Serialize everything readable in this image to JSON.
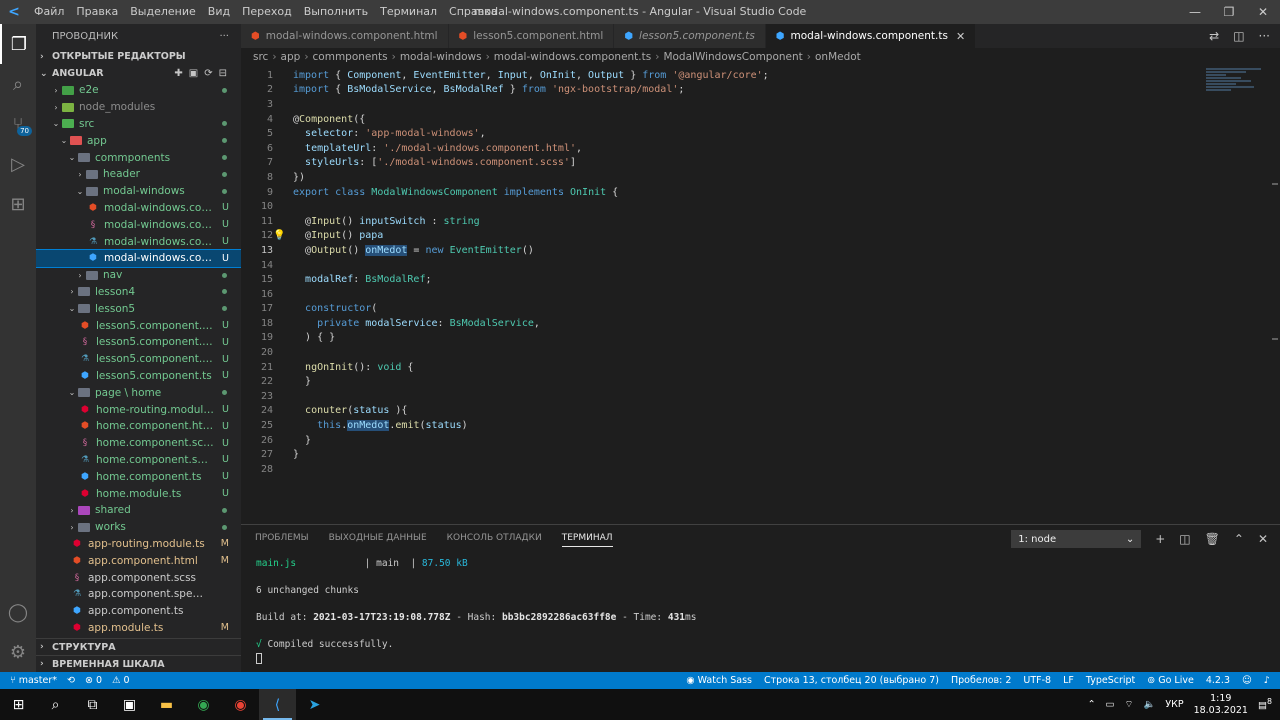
{
  "window": {
    "title": "modal-windows.component.ts - Angular - Visual Studio Code",
    "menu": [
      "Файл",
      "Правка",
      "Выделение",
      "Вид",
      "Переход",
      "Выполнить",
      "Терминал",
      "Справка"
    ]
  },
  "activity": {
    "scm_badge": "70"
  },
  "sidebar": {
    "title": "ПРОВОДНИК",
    "more": "···",
    "open_editors": "ОТКРЫТЫЕ РЕДАКТОРЫ",
    "project": "ANGULAR",
    "tree": [
      {
        "label": "e2e",
        "indent": 1,
        "kind": "folder",
        "fc": "e2e",
        "chev": "›",
        "status": "dot"
      },
      {
        "label": "node_modules",
        "indent": 1,
        "kind": "folder",
        "fc": "node",
        "chev": "›",
        "status": "",
        "ign": true
      },
      {
        "label": "src",
        "indent": 1,
        "kind": "folder",
        "fc": "src",
        "chev": "⌄",
        "status": "dot"
      },
      {
        "label": "app",
        "indent": 2,
        "kind": "folder",
        "fc": "app",
        "chev": "⌄",
        "status": "dot"
      },
      {
        "label": "commponents",
        "indent": 3,
        "kind": "folder",
        "fc": "",
        "chev": "⌄",
        "status": "dot"
      },
      {
        "label": "header",
        "indent": 4,
        "kind": "folder",
        "fc": "",
        "chev": "›",
        "status": "dot"
      },
      {
        "label": "modal-windows",
        "indent": 4,
        "kind": "folder",
        "fc": "",
        "chev": "⌄",
        "status": "dot"
      },
      {
        "label": "modal-windows.compo...",
        "indent": 5,
        "kind": "html",
        "status": "U"
      },
      {
        "label": "modal-windows.compo...",
        "indent": 5,
        "kind": "scss",
        "status": "U"
      },
      {
        "label": "modal-windows.compo...",
        "indent": 5,
        "kind": "spec",
        "status": "U"
      },
      {
        "label": "modal-windows.compo...",
        "indent": 5,
        "kind": "ts",
        "status": "U",
        "selected": true
      },
      {
        "label": "nav",
        "indent": 4,
        "kind": "folder",
        "fc": "",
        "chev": "›",
        "status": "dot"
      },
      {
        "label": "lesson4",
        "indent": 3,
        "kind": "folder",
        "fc": "",
        "chev": "›",
        "status": "dot"
      },
      {
        "label": "lesson5",
        "indent": 3,
        "kind": "folder",
        "fc": "",
        "chev": "⌄",
        "status": "dot"
      },
      {
        "label": "lesson5.component.html",
        "indent": 4,
        "kind": "html",
        "status": "U"
      },
      {
        "label": "lesson5.component.scss",
        "indent": 4,
        "kind": "scss",
        "status": "U"
      },
      {
        "label": "lesson5.component.spec.ts",
        "indent": 4,
        "kind": "spec",
        "status": "U"
      },
      {
        "label": "lesson5.component.ts",
        "indent": 4,
        "kind": "ts",
        "status": "U"
      },
      {
        "label": "page \\ home",
        "indent": 3,
        "kind": "folder",
        "fc": "",
        "chev": "⌄",
        "status": "dot"
      },
      {
        "label": "home-routing.module.ts",
        "indent": 4,
        "kind": "ng",
        "status": "U"
      },
      {
        "label": "home.component.html",
        "indent": 4,
        "kind": "html",
        "status": "U"
      },
      {
        "label": "home.component.scss",
        "indent": 4,
        "kind": "scss",
        "status": "U"
      },
      {
        "label": "home.component.spec.ts",
        "indent": 4,
        "kind": "spec",
        "status": "U"
      },
      {
        "label": "home.component.ts",
        "indent": 4,
        "kind": "ts",
        "status": "U"
      },
      {
        "label": "home.module.ts",
        "indent": 4,
        "kind": "ng",
        "status": "U"
      },
      {
        "label": "shared",
        "indent": 3,
        "kind": "folder",
        "fc": "shared",
        "chev": "›",
        "status": "dot"
      },
      {
        "label": "works",
        "indent": 3,
        "kind": "folder",
        "fc": "",
        "chev": "›",
        "status": "dot"
      },
      {
        "label": "app-routing.module.ts",
        "indent": 3,
        "kind": "ng",
        "status": "M"
      },
      {
        "label": "app.component.html",
        "indent": 3,
        "kind": "html",
        "status": "M"
      },
      {
        "label": "app.component.scss",
        "indent": 3,
        "kind": "scss",
        "status": ""
      },
      {
        "label": "app.component.spec.ts",
        "indent": 3,
        "kind": "spec",
        "status": ""
      },
      {
        "label": "app.component.ts",
        "indent": 3,
        "kind": "ts",
        "status": ""
      },
      {
        "label": "app.module.ts",
        "indent": 3,
        "kind": "ng",
        "status": "M"
      }
    ],
    "outline": "СТРУКТУРА",
    "timeline": "ВРЕМЕННАЯ ШКАЛА"
  },
  "tabs": [
    {
      "label": "modal-windows.component.html",
      "icon": "html",
      "active": false,
      "italic": false
    },
    {
      "label": "lesson5.component.html",
      "icon": "html",
      "active": false,
      "italic": false
    },
    {
      "label": "lesson5.component.ts",
      "icon": "ts",
      "active": false,
      "italic": true
    },
    {
      "label": "modal-windows.component.ts",
      "icon": "ts",
      "active": true,
      "italic": false
    }
  ],
  "breadcrumb": [
    "src",
    "app",
    "commponents",
    "modal-windows",
    "modal-windows.component.ts",
    "ModalWindowsComponent",
    "onMedot"
  ],
  "code": [
    [
      [
        "k",
        "import"
      ],
      [
        "p",
        " { "
      ],
      [
        "v",
        "Component"
      ],
      [
        "p",
        ", "
      ],
      [
        "v",
        "EventEmitter"
      ],
      [
        "p",
        ", "
      ],
      [
        "v",
        "Input"
      ],
      [
        "p",
        ", "
      ],
      [
        "v",
        "OnInit"
      ],
      [
        "p",
        ", "
      ],
      [
        "v",
        "Output"
      ],
      [
        "p",
        " } "
      ],
      [
        "k",
        "from"
      ],
      [
        "p",
        " "
      ],
      [
        "s",
        "'@angular/core'"
      ],
      [
        "p",
        ";"
      ]
    ],
    [
      [
        "k",
        "import"
      ],
      [
        "p",
        " { "
      ],
      [
        "v",
        "BsModalService"
      ],
      [
        "p",
        ", "
      ],
      [
        "v",
        "BsModalRef"
      ],
      [
        "p",
        " } "
      ],
      [
        "k",
        "from"
      ],
      [
        "p",
        " "
      ],
      [
        "s",
        "'ngx-bootstrap/modal'"
      ],
      [
        "p",
        ";"
      ]
    ],
    [],
    [
      [
        "p",
        "@"
      ],
      [
        "f",
        "Component"
      ],
      [
        "p",
        "({"
      ]
    ],
    [
      [
        "p",
        "  "
      ],
      [
        "v",
        "selector"
      ],
      [
        "p",
        ": "
      ],
      [
        "s",
        "'app-modal-windows'"
      ],
      [
        "p",
        ","
      ]
    ],
    [
      [
        "p",
        "  "
      ],
      [
        "v",
        "templateUrl"
      ],
      [
        "p",
        ": "
      ],
      [
        "s",
        "'./modal-windows.component.html'"
      ],
      [
        "p",
        ","
      ]
    ],
    [
      [
        "p",
        "  "
      ],
      [
        "v",
        "styleUrls"
      ],
      [
        "p",
        ": ["
      ],
      [
        "s",
        "'./modal-windows.component.scss'"
      ],
      [
        "p",
        "]"
      ]
    ],
    [
      [
        "p",
        "})"
      ]
    ],
    [
      [
        "k",
        "export"
      ],
      [
        "p",
        " "
      ],
      [
        "k",
        "class"
      ],
      [
        "p",
        " "
      ],
      [
        "t",
        "ModalWindowsComponent"
      ],
      [
        "p",
        " "
      ],
      [
        "k",
        "implements"
      ],
      [
        "p",
        " "
      ],
      [
        "t",
        "OnInit"
      ],
      [
        "p",
        " {"
      ]
    ],
    [],
    [
      [
        "p",
        "  @"
      ],
      [
        "f",
        "Input"
      ],
      [
        "p",
        "() "
      ],
      [
        "v",
        "inputSwitch"
      ],
      [
        "p",
        " : "
      ],
      [
        "t",
        "string"
      ]
    ],
    [
      [
        "p",
        "  @"
      ],
      [
        "f",
        "Input"
      ],
      [
        "p",
        "() "
      ],
      [
        "v",
        "papa"
      ]
    ],
    [
      [
        "p",
        "  @"
      ],
      [
        "f",
        "Output"
      ],
      [
        "p",
        "() "
      ],
      [
        "vh",
        "onMedot"
      ],
      [
        "p",
        " = "
      ],
      [
        "k",
        "new"
      ],
      [
        "p",
        " "
      ],
      [
        "t",
        "EventEmitter"
      ],
      [
        "p",
        "()"
      ]
    ],
    [],
    [
      [
        "p",
        "  "
      ],
      [
        "v",
        "modalRef"
      ],
      [
        "p",
        ": "
      ],
      [
        "t",
        "BsModalRef"
      ],
      [
        "p",
        ";"
      ]
    ],
    [],
    [
      [
        "p",
        "  "
      ],
      [
        "k",
        "constructor"
      ],
      [
        "p",
        "("
      ]
    ],
    [
      [
        "p",
        "    "
      ],
      [
        "k",
        "private"
      ],
      [
        "p",
        " "
      ],
      [
        "v",
        "modalService"
      ],
      [
        "p",
        ": "
      ],
      [
        "t",
        "BsModalService"
      ],
      [
        "p",
        ","
      ]
    ],
    [
      [
        "p",
        "  ) { }"
      ]
    ],
    [],
    [
      [
        "p",
        "  "
      ],
      [
        "f",
        "ngOnInit"
      ],
      [
        "p",
        "(): "
      ],
      [
        "t",
        "void"
      ],
      [
        "p",
        " {"
      ]
    ],
    [
      [
        "p",
        "  }"
      ]
    ],
    [],
    [
      [
        "p",
        "  "
      ],
      [
        "f",
        "conuter"
      ],
      [
        "p",
        "("
      ],
      [
        "v",
        "status"
      ],
      [
        "p",
        " ){"
      ]
    ],
    [
      [
        "p",
        "    "
      ],
      [
        "k",
        "this"
      ],
      [
        "p",
        "."
      ],
      [
        "vh",
        "onMedot"
      ],
      [
        "p",
        "."
      ],
      [
        "f",
        "emit"
      ],
      [
        "p",
        "("
      ],
      [
        "v",
        "status"
      ],
      [
        "p",
        ")"
      ]
    ],
    [
      [
        "p",
        "  }"
      ]
    ],
    [
      [
        "p",
        "}"
      ]
    ],
    []
  ],
  "editor": {
    "current_line": 13
  },
  "panel": {
    "tabs": [
      "ПРОБЛЕМЫ",
      "ВЫХОДНЫЕ ДАННЫЕ",
      "КОНСОЛЬ ОТЛАДКИ",
      "ТЕРМИНАЛ"
    ],
    "active_tab": 3,
    "terminal_select": "1: node",
    "terminal": {
      "chunk_name": "main.js",
      "chunk_pad": "            | ",
      "chunk_label": "main",
      "chunk_sep": "  | ",
      "chunk_size": "87.50 kB",
      "unchanged": "6 unchanged chunks",
      "build_prefix": "Build at: ",
      "build_date": "2021-03-17T23:19:08.778Z",
      "hash_prefix": " - Hash: ",
      "hash": "bb3bc2892286ac63ff8e",
      "time_prefix": " - Time: ",
      "time": "431",
      "time_unit": "ms",
      "check": "√",
      "compiled": " Compiled successfully."
    }
  },
  "status": {
    "branch": "master*",
    "sync": "⟲",
    "errors": "⊗ 0",
    "warnings": "⚠ 0",
    "watch_sass": "Watch Sass",
    "position": "Строка 13, столбец 20 (выбрано 7)",
    "spaces": "Пробелов: 2",
    "encoding": "UTF-8",
    "eol": "LF",
    "language": "TypeScript",
    "golive": "Go Live",
    "version": "4.2.3"
  },
  "taskbar": {
    "lang": "УКР",
    "time": "1:19",
    "date": "18.03.2021",
    "notif": "8"
  }
}
